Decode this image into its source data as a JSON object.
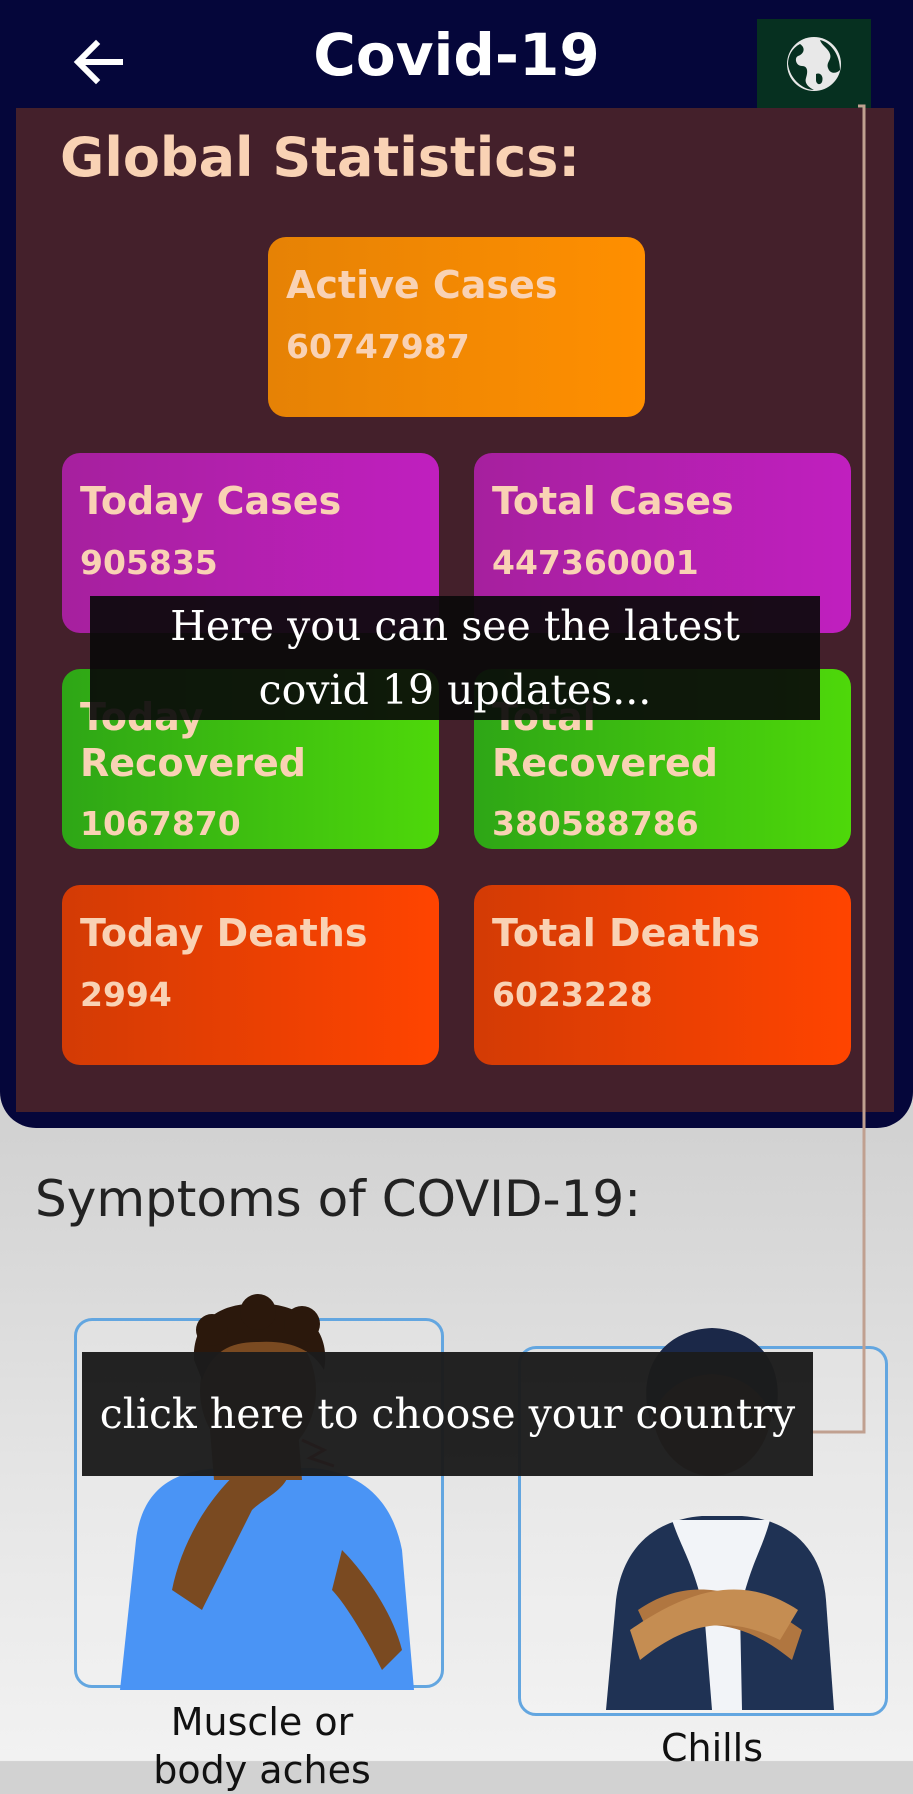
{
  "appbar": {
    "title": "Covid-19",
    "back_icon": "arrow-left-icon",
    "globe_icon": "globe-icon"
  },
  "global_stats": {
    "heading": "Global Statistics:",
    "cards": {
      "active_cases": {
        "label": "Active Cases",
        "value": "60747987",
        "color": "#ff8f00"
      },
      "today_cases": {
        "label": "Today Cases",
        "value": "905835",
        "color": "#c01fbf"
      },
      "total_cases": {
        "label": "Total Cases",
        "value": "447360001",
        "color": "#c01fbf"
      },
      "today_recovered": {
        "label": "Today Recovered",
        "value": "1067870",
        "color": "#4ed80a"
      },
      "total_recovered": {
        "label": "Total Recovered",
        "value": "380588786",
        "color": "#4ed80a"
      },
      "today_deaths": {
        "label": "Today Deaths",
        "value": "2994",
        "color": "#ff4400"
      },
      "total_deaths": {
        "label": "Total Deaths",
        "value": "6023228",
        "color": "#ff4400"
      }
    }
  },
  "tooltips": {
    "updates_line1": "Here you can see the latest",
    "updates_line2": "covid 19 updates...",
    "country": "click here to choose your country"
  },
  "symptoms": {
    "heading": "Symptoms of COVID-19:",
    "items": [
      {
        "label_line1": "Muscle or",
        "label_line2": "body aches",
        "illustration": "man-neck-pain-illustration"
      },
      {
        "label_line1": "Chills",
        "label_line2": "",
        "illustration": "woman-chills-illustration"
      }
    ]
  }
}
